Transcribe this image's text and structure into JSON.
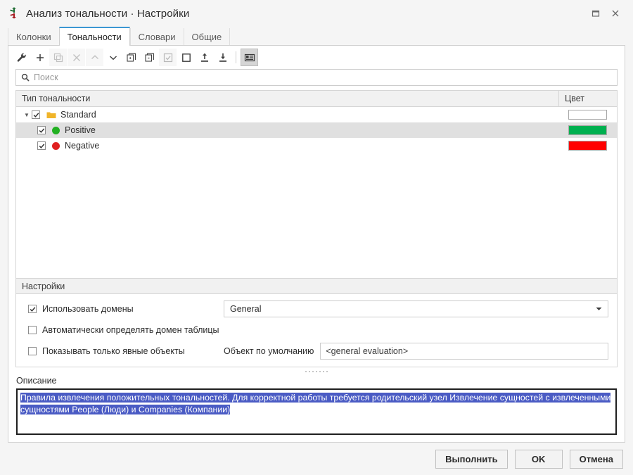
{
  "window": {
    "title": "Анализ тональности · Настройки",
    "app_icon": "sentiment-arrows-icon",
    "maximize_label": "◻",
    "close_label": "✕"
  },
  "tabs": [
    {
      "label": "Колонки",
      "active": false
    },
    {
      "label": "Тональности",
      "active": true
    },
    {
      "label": "Словари",
      "active": false
    },
    {
      "label": "Общие",
      "active": false
    }
  ],
  "toolbar": [
    {
      "name": "settings-wrench-icon",
      "state": "enabled"
    },
    {
      "name": "add-icon",
      "state": "enabled"
    },
    {
      "name": "copy-icon",
      "state": "disabled"
    },
    {
      "name": "delete-icon",
      "state": "disabled"
    },
    {
      "name": "move-up-icon",
      "state": "disabled"
    },
    {
      "name": "move-down-icon",
      "state": "enabled"
    },
    {
      "name": "expand-all-icon",
      "state": "enabled"
    },
    {
      "name": "collapse-all-icon",
      "state": "enabled"
    },
    {
      "name": "check-all-icon",
      "state": "disabled"
    },
    {
      "name": "uncheck-all-icon",
      "state": "enabled"
    },
    {
      "name": "import-icon",
      "state": "enabled"
    },
    {
      "name": "export-icon",
      "state": "enabled"
    },
    {
      "name": "toggle-details-icon",
      "state": "pressed"
    }
  ],
  "search": {
    "placeholder": "Поиск",
    "value": "",
    "icon": "search-icon"
  },
  "tree": {
    "columns": {
      "name": "Тип тональности",
      "color": "Цвет"
    },
    "rows": [
      {
        "label": "Standard",
        "level": 0,
        "expanded": true,
        "checked": true,
        "icon": "folder-icon",
        "icon_color": "#f0b429",
        "color": "#ffffff",
        "selected": false
      },
      {
        "label": "Positive",
        "level": 1,
        "expanded": null,
        "checked": true,
        "icon": "green-dot-icon",
        "icon_color": "#22b022",
        "color": "#00b050",
        "selected": true
      },
      {
        "label": "Negative",
        "level": 1,
        "expanded": null,
        "checked": true,
        "icon": "red-dot-icon",
        "icon_color": "#e02020",
        "color": "#ff0000",
        "selected": false
      }
    ]
  },
  "settings": {
    "group_title": "Настройки",
    "use_domains": {
      "label": "Использовать домены",
      "checked": true
    },
    "domain_combo": {
      "value": "General"
    },
    "auto_detect_domain": {
      "label": "Автоматически определять домен таблицы",
      "checked": false
    },
    "show_explicit_only": {
      "label": "Показывать только явные объекты",
      "checked": false
    },
    "default_object": {
      "label": "Объект по умолчанию",
      "value": "<general evaluation>"
    }
  },
  "description": {
    "label": "Описание",
    "text": "Правила извлечения положительных тональностей. Для корректной работы требуется родительский узел Извлечение сущностей с извлеченными сущностями People (Люди) и Companies (Компании)",
    "selection_color": "#4a5bc4"
  },
  "footer": {
    "run_label": "Выполнить",
    "ok_label": "OK",
    "cancel_label": "Отмена"
  }
}
